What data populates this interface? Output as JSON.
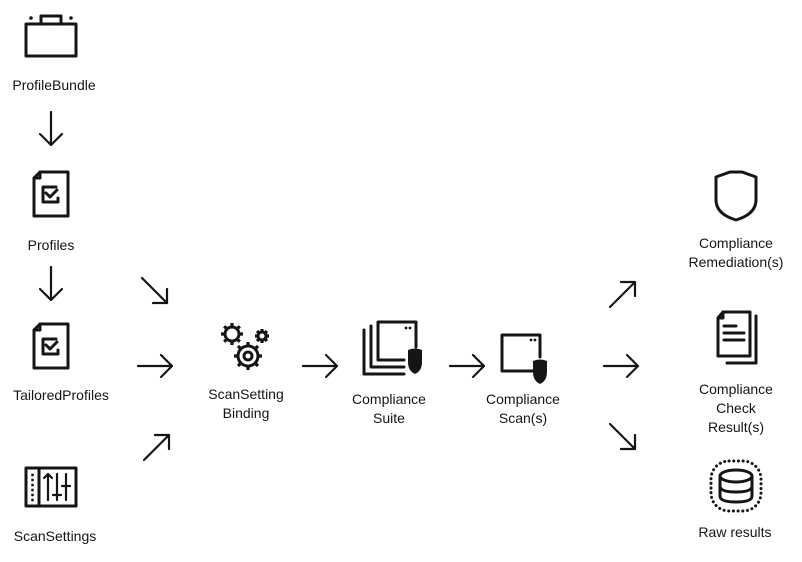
{
  "nodes": {
    "profile_bundle": {
      "label": "ProfileBundle",
      "icon": "briefcase-icon"
    },
    "profiles": {
      "label": "Profiles",
      "icon": "checklist-document-icon"
    },
    "tailored_profiles": {
      "label": "TailoredProfiles",
      "icon": "checklist-document-icon"
    },
    "scan_settings": {
      "label": "ScanSettings",
      "icon": "sliders-icon"
    },
    "scan_setting_binding": {
      "label_line1": "ScanSetting",
      "label_line2": "Binding",
      "icon": "gears-icon"
    },
    "compliance_suite": {
      "label_line1": "Compliance",
      "label_line2": "Suite",
      "icon": "stacked-windows-shield-icon"
    },
    "compliance_scan": {
      "label_line1": "Compliance",
      "label_line2": "Scan(s)",
      "icon": "window-shield-icon"
    },
    "compliance_remediation": {
      "label_line1": "Compliance",
      "label_line2": "Remediation(s)",
      "icon": "shield-icon"
    },
    "compliance_check_result": {
      "label_line1": "Compliance",
      "label_line2": "Check",
      "label_line3": "Result(s)",
      "icon": "documents-icon"
    },
    "raw_results": {
      "label": "Raw results",
      "icon": "database-icon"
    }
  },
  "edges": [
    {
      "from": "ProfileBundle",
      "to": "Profiles",
      "direction": "down"
    },
    {
      "from": "Profiles",
      "to": "TailoredProfiles",
      "direction": "down"
    },
    {
      "from": "Profiles",
      "to": "ScanSettingBinding",
      "direction": "down-right"
    },
    {
      "from": "TailoredProfiles",
      "to": "ScanSettingBinding",
      "direction": "right"
    },
    {
      "from": "ScanSettings",
      "to": "ScanSettingBinding",
      "direction": "up-right"
    },
    {
      "from": "ScanSettingBinding",
      "to": "ComplianceSuite",
      "direction": "right"
    },
    {
      "from": "ComplianceSuite",
      "to": "ComplianceScan(s)",
      "direction": "right"
    },
    {
      "from": "ComplianceScan(s)",
      "to": "ComplianceRemediation(s)",
      "direction": "up-right"
    },
    {
      "from": "ComplianceScan(s)",
      "to": "ComplianceCheckResult(s)",
      "direction": "right"
    },
    {
      "from": "ComplianceScan(s)",
      "to": "Raw results",
      "direction": "down-right"
    }
  ],
  "colors": {
    "ink": "#151515",
    "background": "#ffffff"
  }
}
